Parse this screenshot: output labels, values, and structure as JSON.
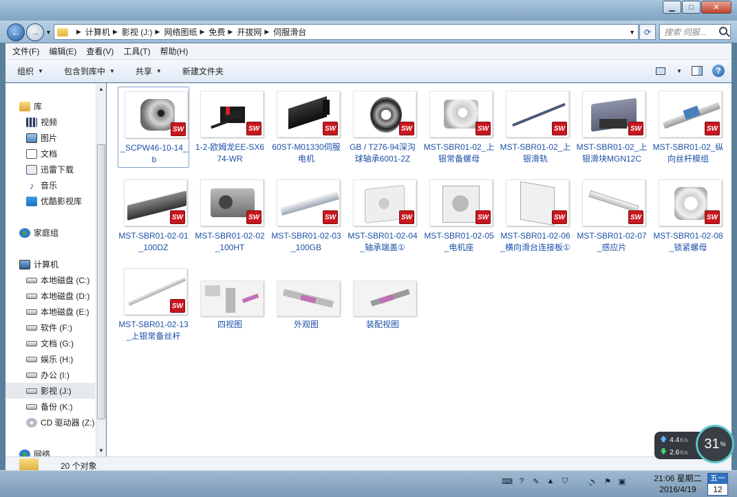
{
  "window": {
    "controls": {
      "minimize": "▁",
      "maximize": "□",
      "close": "✕"
    }
  },
  "address": {
    "back": "←",
    "forward": "→",
    "breadcrumbs": [
      "计算机",
      "影视 (J:)",
      "网络图纸",
      "免费",
      "开拔网",
      "伺服滑台"
    ],
    "search_placeholder": "搜索 伺服..."
  },
  "menu": [
    "文件(F)",
    "编辑(E)",
    "查看(V)",
    "工具(T)",
    "帮助(H)"
  ],
  "toolbar": {
    "organize": "组织",
    "include_in_library": "包含到库中",
    "share": "共享",
    "new_folder": "新建文件夹"
  },
  "nav": {
    "libraries": {
      "title": "库",
      "items": [
        "视频",
        "图片",
        "文档",
        "迅雷下载",
        "音乐",
        "优酷影视库"
      ]
    },
    "homegroup": "家庭组",
    "computer": {
      "title": "计算机",
      "items": [
        "本地磁盘 (C:)",
        "本地磁盘 (D:)",
        "本地磁盘 (E:)",
        "软件 (F:)",
        "文档 (G:)",
        "娱乐 (H:)",
        "办公 (I:)",
        "影视 (J:)",
        "备份 (K:)",
        "CD 驱动器 (Z:)"
      ],
      "selected_index": 7
    },
    "network": "网络"
  },
  "files": [
    {
      "name": "_SCPW46-10-14_b",
      "icon": "coupling-part",
      "sw": true,
      "selected": true
    },
    {
      "name": "1-2-欧姆龙EE-SX674-WR",
      "icon": "sensor-part",
      "sw": true
    },
    {
      "name": "60ST-M01330伺服电机",
      "icon": "motor-part",
      "sw": true
    },
    {
      "name": "GB / T276-94深沟球轴承6001-2Z",
      "icon": "bearing-part",
      "sw": true
    },
    {
      "name": "MST-SBR01-02_上银常备螺母",
      "icon": "nut-part",
      "sw": true
    },
    {
      "name": "MST-SBR01-02_上银滑轨",
      "icon": "rail-part",
      "sw": true
    },
    {
      "name": "MST-SBR01-02_上银滑块MGN12C",
      "icon": "block-part",
      "sw": true
    },
    {
      "name": "MST-SBR01-02_纵向丝杆模组",
      "icon": "screw-module",
      "sw": true
    },
    {
      "name": "MST-SBR01-02-01_100DZ",
      "icon": "base-part",
      "sw": true
    },
    {
      "name": "MST-SBR01-02-02_100HT",
      "icon": "slider-part",
      "sw": true
    },
    {
      "name": "MST-SBR01-02-03_100GB",
      "icon": "cover-part",
      "sw": true
    },
    {
      "name": "MST-SBR01-02-04_轴承端盖①",
      "icon": "endcap-part",
      "sw": true
    },
    {
      "name": "MST-SBR01-02-05_电机座",
      "icon": "motor-mount",
      "sw": true
    },
    {
      "name": "MST-SBR01-02-06_横向滑台连接板①",
      "icon": "plate-part",
      "sw": true
    },
    {
      "name": "MST-SBR01-02-07_感应片",
      "icon": "flag-part",
      "sw": true
    },
    {
      "name": "MST-SBR01-02-08_锁紧螺母",
      "icon": "locknut-part",
      "sw": true
    },
    {
      "name": "MST-SBR01-02-13_上银常备丝杆",
      "icon": "leadscrew-part",
      "sw": true
    },
    {
      "name": "四视图",
      "icon": "screenshot-four-view",
      "sw": false
    },
    {
      "name": "外观图",
      "icon": "screenshot-appearance",
      "sw": false
    },
    {
      "name": "装配视图",
      "icon": "screenshot-assembly",
      "sw": false
    }
  ],
  "sw_badge": "SW",
  "status": {
    "count": "20 个对象"
  },
  "speed": {
    "up": "4.4",
    "down": "2.6",
    "unit": "K/s",
    "percent": "31",
    "percent_unit": "%"
  },
  "taskbar": {
    "time": "21:06 星期二",
    "date": "2016/4/19",
    "cal_top": "五一",
    "cal_num": "12"
  },
  "colors": {
    "link_text": "#1d4fa8",
    "sw_red": "#c8171e",
    "selection": "#7da2ce"
  }
}
